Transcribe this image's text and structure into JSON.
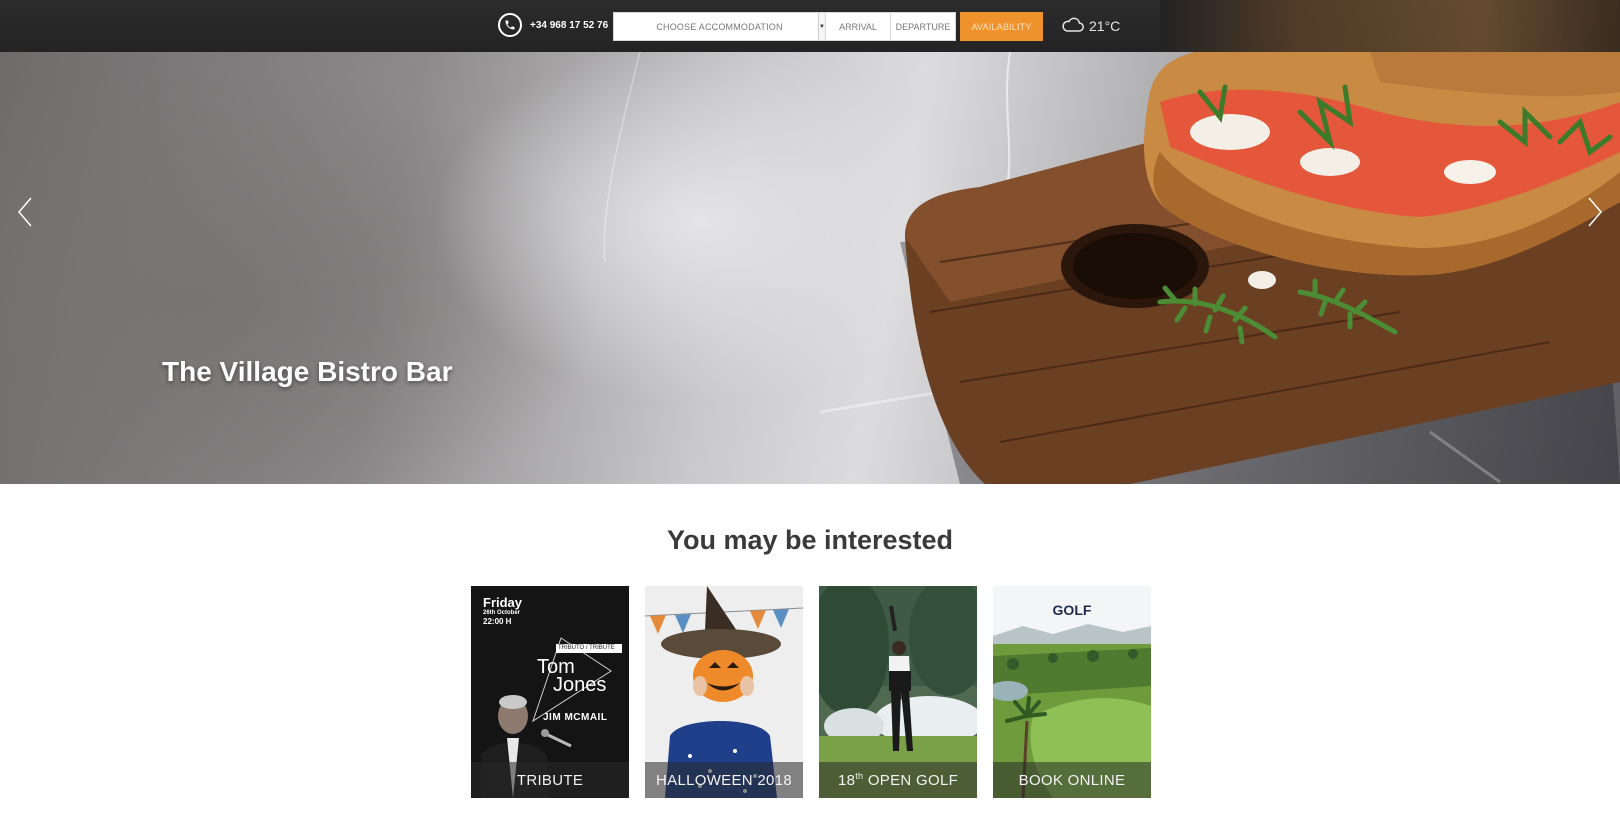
{
  "topbar": {
    "phone": "+34 968 17 52 76",
    "booking": {
      "accommodation_placeholder": "CHOOSE ACCOMMODATION",
      "arrival_placeholder": "ARRIVAL",
      "departure_placeholder": "DEPARTURE",
      "availability_label": "AVAILABILITY"
    },
    "weather": {
      "icon": "cloud-icon",
      "temperature": "21°C"
    }
  },
  "hero": {
    "title": "The Village Bistro Bar",
    "prev_icon": "chevron-left-icon",
    "next_icon": "chevron-right-icon"
  },
  "interested": {
    "title": "You may be interested",
    "cards": [
      {
        "label": "TRIBUTE",
        "poster": {
          "day": "Friday",
          "date": "26th October",
          "time": "22:00 H",
          "tag": "TRIBUTO / TRIBUTE",
          "name_line1": "Tom",
          "name_line2": "Jones",
          "performer": "JIM MCMAIL"
        }
      },
      {
        "label": "HALLOWEEN 2018"
      },
      {
        "label_num": "18",
        "label_sup": "th",
        "label_rest": " OPEN GOLF"
      },
      {
        "label": "BOOK ONLINE",
        "poster_heading": "GOLF"
      }
    ]
  },
  "colors": {
    "topbar": "#262626",
    "availability_button": "#f0922c",
    "section_title": "#3a3a3a"
  }
}
